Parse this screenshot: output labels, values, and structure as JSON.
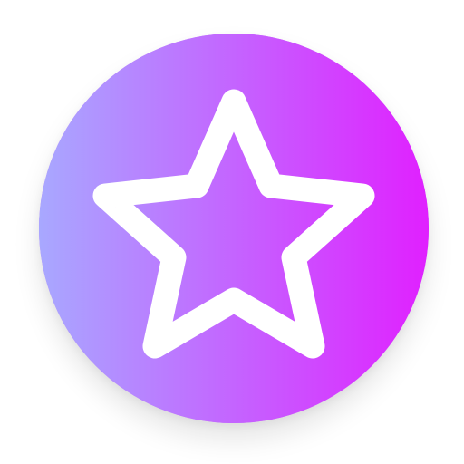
{
  "icon": {
    "name": "star-icon",
    "gradient_start": "#A8A8FF",
    "gradient_end": "#E020FF",
    "star_color": "#FFFFFF"
  }
}
